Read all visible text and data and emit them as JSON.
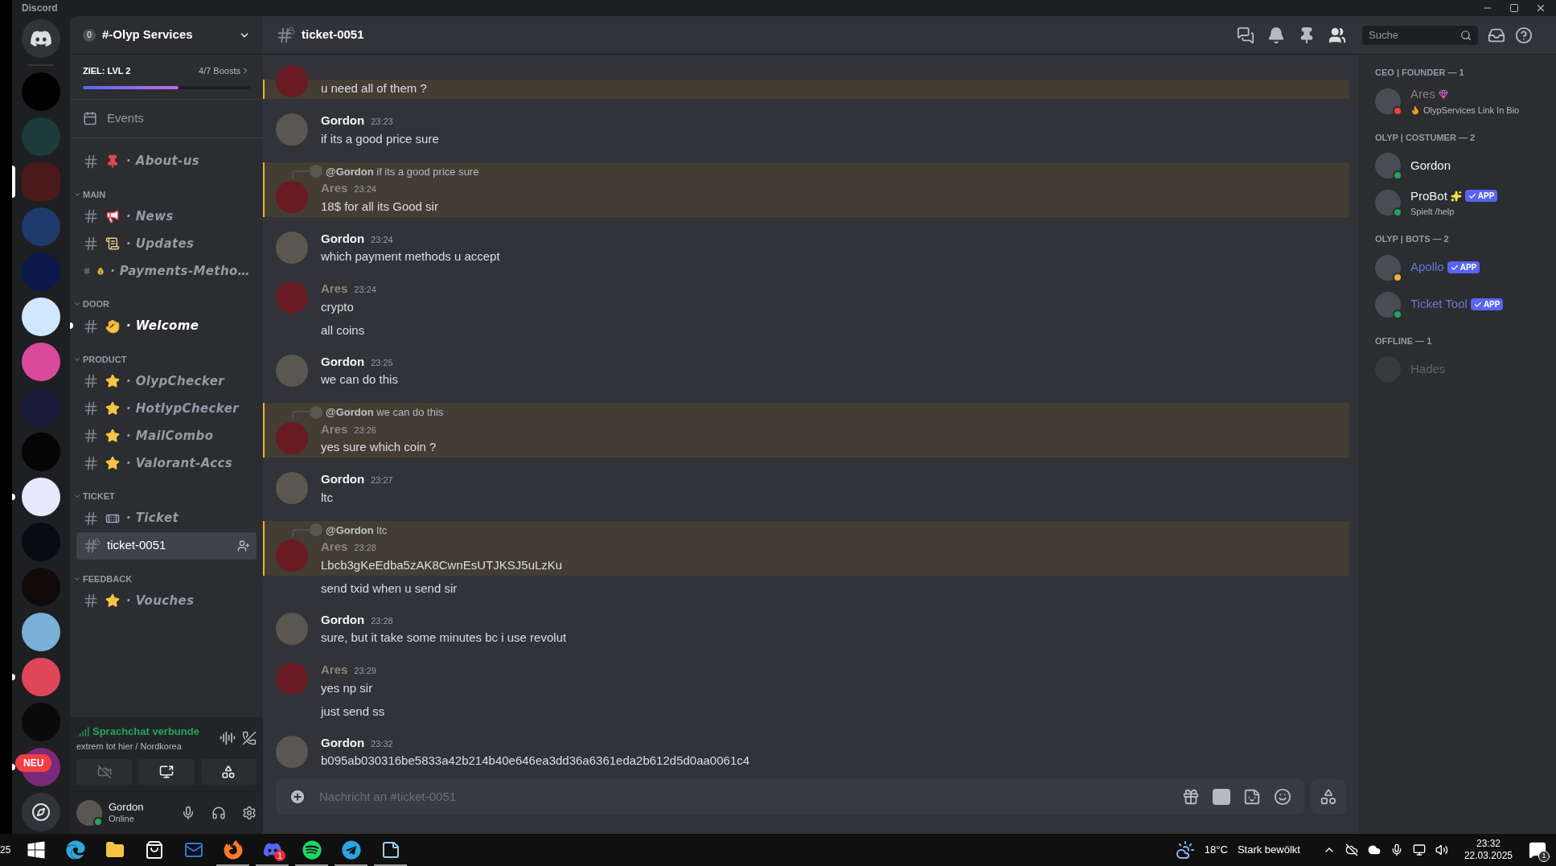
{
  "window": {
    "title": "Discord"
  },
  "servers": [
    {
      "kind": "home",
      "color": "#313338",
      "selected": false,
      "unread": false
    },
    {
      "kind": "server",
      "color": "#000000",
      "selected": false,
      "unread": false
    },
    {
      "kind": "server",
      "color": "#1c3b3a",
      "selected": false,
      "unread": false
    },
    {
      "kind": "server",
      "color": "#4a1a1a",
      "selected": true,
      "unread": false
    },
    {
      "kind": "server",
      "color": "#1e3a6b",
      "selected": false,
      "unread": false
    },
    {
      "kind": "server",
      "color": "#0b1a4a",
      "selected": false,
      "unread": false
    },
    {
      "kind": "server",
      "color": "#cfe8ff",
      "selected": false,
      "unread": false
    },
    {
      "kind": "server",
      "color": "#d94a9a",
      "selected": false,
      "unread": false
    },
    {
      "kind": "server",
      "color": "#1a1a3a",
      "selected": false,
      "unread": false
    },
    {
      "kind": "server",
      "color": "#050505",
      "selected": false,
      "unread": false
    },
    {
      "kind": "server",
      "color": "#e8e8ff",
      "selected": false,
      "unread": true
    },
    {
      "kind": "server",
      "color": "#0a0a12",
      "selected": false,
      "unread": false
    },
    {
      "kind": "server",
      "color": "#120a0a",
      "selected": false,
      "unread": false
    },
    {
      "kind": "server",
      "color": "#7ab0d8",
      "selected": false,
      "unread": false
    },
    {
      "kind": "server",
      "color": "#e0455a",
      "selected": false,
      "unread": true
    },
    {
      "kind": "server",
      "color": "#0a0a0a",
      "selected": false,
      "unread": false
    },
    {
      "kind": "server",
      "color": "#7a2a7a",
      "selected": false,
      "unread": true,
      "badge": "NEU"
    },
    {
      "kind": "explore",
      "color": "#313338",
      "selected": false,
      "unread": false
    }
  ],
  "sidebar": {
    "server_name": "#-Olyp Services",
    "badge": "0",
    "boost": {
      "goal": "ZIEL: LVL 2",
      "count": "4/7 Boosts",
      "level": 0.57
    },
    "events": "Events",
    "top_channels": [
      {
        "kind": "pin",
        "name": "· About-us",
        "unread": false,
        "selected": false
      }
    ],
    "categories": [
      {
        "name": "MAIN",
        "channels": [
          {
            "kind": "megaphone",
            "name": "· News",
            "unread": false,
            "selected": false
          },
          {
            "kind": "scroll",
            "name": "· Updates",
            "unread": false,
            "selected": false
          },
          {
            "kind": "moneybag",
            "name": "· Payments-Metho…",
            "unread": false,
            "selected": false
          }
        ]
      },
      {
        "name": "DOOR",
        "channels": [
          {
            "kind": "wave",
            "name": "· Welcome",
            "unread": true,
            "selected": false
          }
        ]
      },
      {
        "name": "PRODUCT",
        "channels": [
          {
            "kind": "star",
            "name": "· OlypChecker",
            "unread": false,
            "selected": false
          },
          {
            "kind": "star",
            "name": "· HotlypChecker",
            "unread": false,
            "selected": false
          },
          {
            "kind": "star",
            "name": "· MailCombo",
            "unread": false,
            "selected": false
          },
          {
            "kind": "star",
            "name": "· Valorant-Accs",
            "unread": false,
            "selected": false
          }
        ]
      },
      {
        "name": "TICKET",
        "channels": [
          {
            "kind": "bandage",
            "name": "· Ticket",
            "unread": false,
            "selected": false
          },
          {
            "kind": "private",
            "name": "ticket-0051",
            "unread": false,
            "selected": true
          }
        ]
      },
      {
        "name": "FEEDBACK",
        "channels": [
          {
            "kind": "star",
            "name": "· Vouches",
            "unread": false,
            "selected": false
          }
        ]
      }
    ],
    "voice": {
      "status": "Sprachchat verbunde",
      "channel": "extrem tot hier / Nordkorea"
    },
    "user": {
      "name": "Gordon",
      "status": "Online"
    }
  },
  "header": {
    "channel": "ticket-0051",
    "search": {
      "placeholder": "Suche"
    }
  },
  "messages": [
    {
      "lines": [
        {
          "text": "u need all of them ?",
          "highlighted": true
        }
      ]
    },
    {
      "author": "Gordon",
      "color": "#f2f3f5",
      "time": "23:23",
      "lines": [
        {
          "text": "if its a good price sure",
          "highlighted": false
        }
      ]
    },
    {
      "reply": {
        "author": "@Gordon",
        "text": "if its a good price sure"
      },
      "author": "Ares",
      "color": "#8a857e",
      "time": "23:24",
      "lines": [
        {
          "text": "18$ for all its Good sir",
          "highlighted": true
        }
      ]
    },
    {
      "author": "Gordon",
      "color": "#f2f3f5",
      "time": "23:24",
      "lines": [
        {
          "text": "which payment methods u accept",
          "highlighted": false
        }
      ]
    },
    {
      "author": "Ares",
      "color": "#8a857e",
      "time": "23:24",
      "lines": [
        {
          "text": "crypto",
          "highlighted": false
        },
        {
          "text": "all coins",
          "highlighted": false
        }
      ]
    },
    {
      "author": "Gordon",
      "color": "#f2f3f5",
      "time": "23:25",
      "lines": [
        {
          "text": "we can do this",
          "highlighted": false
        }
      ]
    },
    {
      "reply": {
        "author": "@Gordon",
        "text": "we can do this"
      },
      "author": "Ares",
      "color": "#8a857e",
      "time": "23:26",
      "lines": [
        {
          "text": "yes sure which coin ?",
          "highlighted": true
        }
      ]
    },
    {
      "author": "Gordon",
      "color": "#f2f3f5",
      "time": "23:27",
      "lines": [
        {
          "text": "ltc",
          "highlighted": false
        }
      ]
    },
    {
      "reply": {
        "author": "@Gordon",
        "text": "ltc"
      },
      "author": "Ares",
      "color": "#8a857e",
      "time": "23:28",
      "lines": [
        {
          "text": "Lbcb3gKeEdba5zAK8CwnEsUTJKSJ5uLzKu",
          "highlighted": true
        },
        {
          "text": "send txid when u send sir",
          "highlighted": false
        }
      ]
    },
    {
      "author": "Gordon",
      "color": "#f2f3f5",
      "time": "23:28",
      "lines": [
        {
          "text": "sure, but it take some minutes bc i use revolut",
          "highlighted": false
        }
      ]
    },
    {
      "author": "Ares",
      "color": "#8a857e",
      "time": "23:29",
      "lines": [
        {
          "text": "yes np sir",
          "highlighted": false
        },
        {
          "text": "just send ss",
          "highlighted": false
        }
      ]
    },
    {
      "author": "Gordon",
      "color": "#f2f3f5",
      "time": "23:32",
      "lines": [
        {
          "text": "b095ab030316be5833a42b214b40e646ea3dd36a6361eda2b612d5d0aa0061c4",
          "highlighted": false
        }
      ]
    }
  ],
  "composer": {
    "placeholder": "Nachricht an #ticket-0051"
  },
  "members": [
    {
      "title": "CEO | FOUNDER — 1",
      "color": "#85807a",
      "items": [
        {
          "name": "Ares",
          "color": "#f23f43",
          "kind": "gem",
          "activity": "OlypServices Link In Bio"
        }
      ]
    },
    {
      "title": "OLYP | COSTUMER — 2",
      "color": "#f2f3f5",
      "items": [
        {
          "name": "Gordon",
          "color": "#23a55a",
          "kind": "plain"
        },
        {
          "name": "ProBot",
          "color": "#23a55a",
          "kind": "sparkles",
          "badge": "APP",
          "activity": "Spielt /help"
        }
      ]
    },
    {
      "title": "OLYP | BOTS — 2",
      "color": "#6a76d0",
      "items": [
        {
          "name": "Apollo",
          "color": "#f0b232",
          "kind": "plain",
          "badge": "APP"
        },
        {
          "name": "Ticket Tool",
          "color": "#23a55a",
          "kind": "plain",
          "badge": "APP"
        }
      ]
    },
    {
      "title": "OFFLINE — 1",
      "color": "#62646a",
      "items": [
        {
          "name": "Hades",
          "kind": "plain"
        }
      ]
    }
  ],
  "taskbar": {
    "cut_text": "25",
    "apps": [
      {
        "kind": "windows",
        "running": false
      },
      {
        "kind": "edge",
        "running": false
      },
      {
        "kind": "explorer",
        "running": false
      },
      {
        "kind": "store",
        "running": false
      },
      {
        "kind": "outlook",
        "running": false
      },
      {
        "kind": "firefox",
        "running": true
      },
      {
        "kind": "discord",
        "running": true,
        "badge": "1"
      },
      {
        "kind": "spotify",
        "running": true
      },
      {
        "kind": "telegram",
        "running": true
      },
      {
        "kind": "notepad",
        "running": true
      }
    ],
    "weather": {
      "temp": "18°C",
      "text": "Stark bewölkt"
    },
    "time": "23:32",
    "date": "22.03.2025",
    "notifications": "1"
  }
}
